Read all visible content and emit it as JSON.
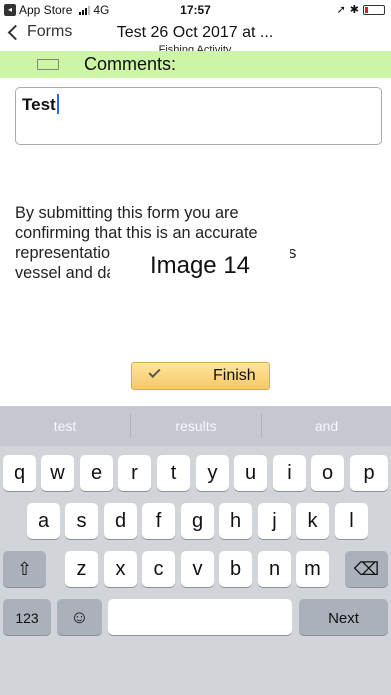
{
  "status_bar": {
    "carrier_app": "App Store",
    "network": "4G",
    "time": "17:57",
    "status_icons": "location bluetooth",
    "battery_level": 0.15,
    "colors": {
      "battery_low": "#e02020"
    }
  },
  "nav": {
    "back_label": "Forms",
    "title": "Test 26 Oct 2017 at ...",
    "subtitle": "Fishing Activity"
  },
  "comments": {
    "label": "Comments:",
    "value": "Test"
  },
  "disclaimer": {
    "lines": [
      "By submitting this form you are",
      "confirming that this is an accurate",
      "representation of fishing activity for this",
      "vessel and date"
    ]
  },
  "finish_button": {
    "label": "Finish",
    "icon": "checkmark-icon"
  },
  "keyboard": {
    "suggestions": [
      "test",
      "results",
      "and"
    ],
    "row1": [
      "q",
      "w",
      "e",
      "r",
      "t",
      "y",
      "u",
      "i",
      "o",
      "p"
    ],
    "row2": [
      "a",
      "s",
      "d",
      "f",
      "g",
      "h",
      "j",
      "k",
      "l"
    ],
    "row3": [
      "z",
      "x",
      "c",
      "v",
      "b",
      "n",
      "m"
    ],
    "numbers_label": "123",
    "space_overlay_label": "Image 14",
    "return_label": "Next",
    "icons": [
      "shift-icon",
      "backspace-icon",
      "emoji-icon"
    ]
  },
  "colors": {
    "comments_header_bg": "#ccf5a6",
    "finish_button_bg": "#f5c869",
    "caret": "#1b6ef3",
    "keyboard_bg": "#d1d4d9"
  }
}
